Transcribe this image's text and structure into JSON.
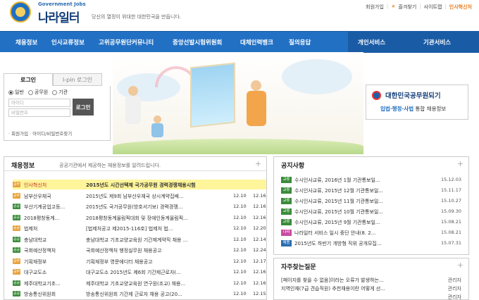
{
  "brand": {
    "small": "Government Jobs",
    "name": "나라일터",
    "slogan": "당신의 열정이 위대한 대한민국을 만듭니다."
  },
  "toplinks": [
    "회원가입",
    "즐겨찾기",
    "사이트맵",
    "인사혁신처"
  ],
  "nav": {
    "items": [
      "채용정보",
      "인사교류정보",
      "고위공무원단커뮤니티",
      "중앙선발시험위원회",
      "대체인력뱅크",
      "질의응답"
    ],
    "right": [
      "개인서비스",
      "기관서비스"
    ]
  },
  "login": {
    "tabs": [
      "로그인",
      "I-pin 로그인"
    ],
    "radios": [
      "일반",
      "공무원",
      "기관"
    ],
    "id_placeholder": "아이디",
    "pw_placeholder": "비밀번호",
    "button": "로그인",
    "links": "· 회원가입 · 아이디/비밀번호찾기"
  },
  "banner": {
    "title": "대한민국공무원되기",
    "sub_prefix": "입법·행정·사법",
    "sub_suffix": " 통합 채용정보"
  },
  "jobs": {
    "title": "채용정보",
    "desc": "공공기관에서 제공하는 채용정보를 알려드립니다.",
    "rows": [
      {
        "badge": "공무",
        "badge_color": "#e6a23c",
        "org": "인사혁신처",
        "title": "2015년도 시간선택제 국가공무원 경력경쟁채용시험",
        "d1": "",
        "d2": "",
        "highlight": true
      },
      {
        "badge": "공무",
        "badge_color": "#e6a23c",
        "org": "남부산우체국",
        "title": "2015년도 제9회 남부산우체국 상시계약집배...",
        "d1": "12.10",
        "d2": "12.16",
        "highlight": false
      },
      {
        "badge": "공공",
        "badge_color": "#3a8b3a",
        "org": "부산기계공업고등...",
        "title": "2015년도 국가공무원(방호서기보) 경력경쟁...",
        "d1": "12.10",
        "d2": "12.16",
        "highlight": false
      },
      {
        "badge": "공공",
        "badge_color": "#3a8b3a",
        "org": "2018평창동계...",
        "title": "2018평창동계올림픽대회 및 장애인동계올림픽...",
        "d1": "12.10",
        "d2": "12.16",
        "highlight": false
      },
      {
        "badge": "공공",
        "badge_color": "#e6a23c",
        "org": "법제처",
        "title": "[법제처공고 제2015-116호] 법제처 법...",
        "d1": "12.10",
        "d2": "12.20",
        "highlight": false
      },
      {
        "badge": "공공",
        "badge_color": "#3a8b3a",
        "org": "충남대학교",
        "title": "충남대학교 기초교양교육원 기간제계약직 채용 ...",
        "d1": "12.10",
        "d2": "12.14",
        "highlight": false
      },
      {
        "badge": "공공",
        "badge_color": "#3a8b3a",
        "org": "국회예산정책처",
        "title": "국회예산정책처 행정실무원 채용공고",
        "d1": "12.10",
        "d2": "12.24",
        "highlight": false
      },
      {
        "badge": "공무",
        "badge_color": "#e6a23c",
        "org": "기획재정부",
        "title": "기획재정부 영문에디터 채용공고",
        "d1": "12.10",
        "d2": "12.17",
        "highlight": false
      },
      {
        "badge": "공무",
        "badge_color": "#e6a23c",
        "org": "대구교도소",
        "title": "대구교도소 2015년도 제6회 기간제근로자(...",
        "d1": "12.10",
        "d2": "12.16",
        "highlight": false
      },
      {
        "badge": "공공",
        "badge_color": "#3a8b3a",
        "org": "제주대학교기초...",
        "title": "제주대학교 기초교양교육원 연구원(조교) 채용...",
        "d1": "12.10",
        "d2": "12.16",
        "highlight": false
      },
      {
        "badge": "공공",
        "badge_color": "#3a8b3a",
        "org": "방송통신위원회",
        "title": "방송통신위원회 기간제 근로자 채용 공고(20...",
        "d1": "12.10",
        "d2": "12.15",
        "highlight": false
      }
    ]
  },
  "notices": {
    "title": "공지사항",
    "rows": [
      {
        "badge": "교류",
        "color": "green",
        "text": "수시인사교류, 2016년 1월 기관통보일...",
        "date": "15.12.03"
      },
      {
        "badge": "교류",
        "color": "green",
        "text": "수시인사교류, 2015년 12월 기관통보일...",
        "date": "15.11.17"
      },
      {
        "badge": "교류",
        "color": "green",
        "text": "수시인사교류, 2015년 11월 기관통보일...",
        "date": "15.10.27"
      },
      {
        "badge": "교류",
        "color": "green",
        "text": "수시인사교류, 2015년 10월 기관통보일...",
        "date": "15.09.30"
      },
      {
        "badge": "교류",
        "color": "green",
        "text": "수시인사교류, 2015년 9월 기관통보일...",
        "date": "15.08.21"
      },
      {
        "badge": "나라",
        "color": "pink",
        "text": "나라일터 서비스 일시 중단 안내(8. 2...",
        "date": "15.08.21"
      },
      {
        "badge": "채용",
        "color": "blue",
        "text": "2015년도 하반기 개방형 직위 공개모집...",
        "date": "15.07.31"
      }
    ]
  },
  "faq": {
    "title": "자주찾는질문",
    "rows": [
      {
        "text": "[페이지를 찾을 수 없음]이라는 오류가 발생하는...",
        "who": "관리자"
      },
      {
        "text": "지역인재(7급 견습직원) 추천채용이란 어떻게 선...",
        "who": "관리자"
      },
      {
        "text": "",
        "who": "관리자"
      }
    ]
  }
}
